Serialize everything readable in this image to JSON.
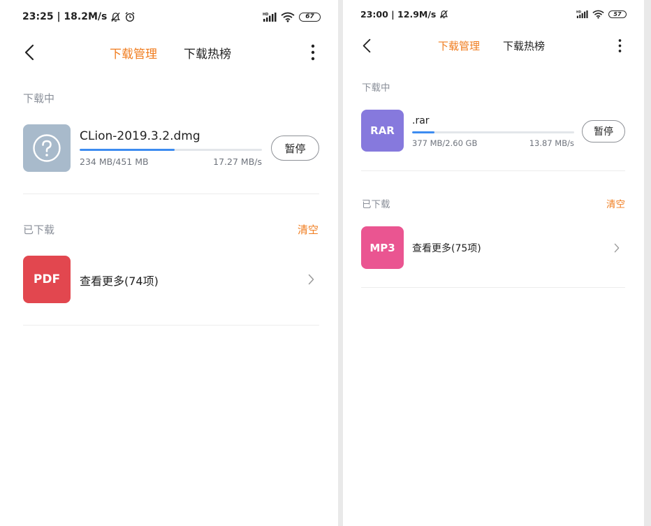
{
  "left": {
    "status": {
      "time_speed": "23:25 | 18.2M/s",
      "battery": "67"
    },
    "nav": {
      "tabs": [
        "下载管理",
        "下载热榜"
      ]
    },
    "downloading": {
      "label": "下载中",
      "item": {
        "icon": "question-mark-icon",
        "name": "CLion-2019.3.2.dmg",
        "size": "234 MB/451 MB",
        "speed": "17.27 MB/s",
        "progress": 0.52,
        "pause_label": "暂停"
      }
    },
    "downloaded": {
      "label": "已下载",
      "clear_label": "清空",
      "item": {
        "type": "PDF",
        "label": "查看更多(74项)",
        "color": "#e2474f"
      }
    }
  },
  "right": {
    "status": {
      "time_speed": "23:00 | 12.9M/s",
      "battery": "57"
    },
    "nav": {
      "tabs": [
        "下载管理",
        "下载热榜"
      ]
    },
    "downloading": {
      "label": "下载中",
      "item": {
        "type": "RAR",
        "color": "#8679dd",
        "name": ".rar",
        "size": "377 MB/2.60 GB",
        "speed": "13.87 MB/s",
        "progress": 0.14,
        "pause_label": "暂停"
      }
    },
    "downloaded": {
      "label": "已下载",
      "clear_label": "清空",
      "item": {
        "type": "MP3",
        "label": "查看更多(75项)",
        "color": "#ea5591"
      }
    }
  },
  "colors": {
    "accent": "#f07c1e",
    "progress": "#3d8cf0",
    "unknown_file": "#a8bacb"
  }
}
